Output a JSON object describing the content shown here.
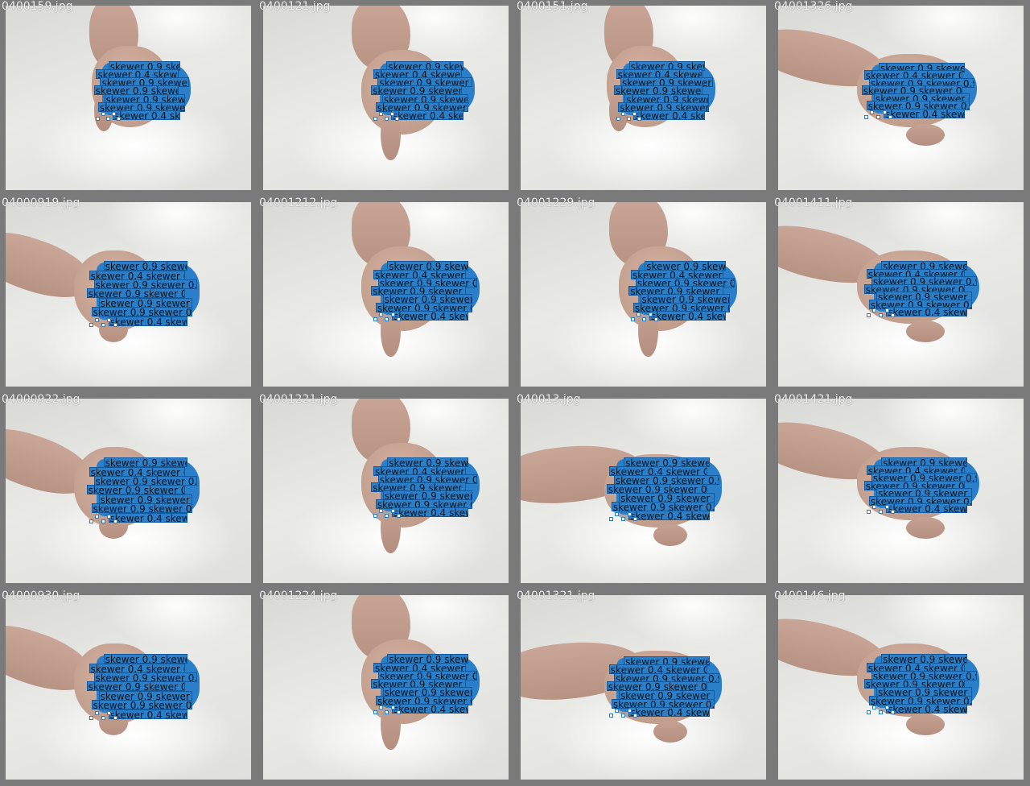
{
  "grid": {
    "files": [
      "0400159.jpg",
      "0400121.jpg",
      "0400151.jpg",
      "04001326.jpg",
      "04000919.jpg",
      "04001212.jpg",
      "04001229.jpg",
      "04001411.jpg",
      "04000922.jpg",
      "04001221.jpg",
      "040013.jpg",
      "04001421.jpg",
      "04000930.jpg",
      "04001224.jpg",
      "04001321.jpg",
      "0400146.jpg"
    ],
    "detection_label": "skewer",
    "detection_scores": [
      "0.9",
      "0.4",
      "0.9",
      "0.9",
      "0.9"
    ]
  },
  "colors": {
    "box_fill": "#2a7fc8",
    "frame_border": "#7a7a7a",
    "filename_text": "#f2f2f2"
  }
}
